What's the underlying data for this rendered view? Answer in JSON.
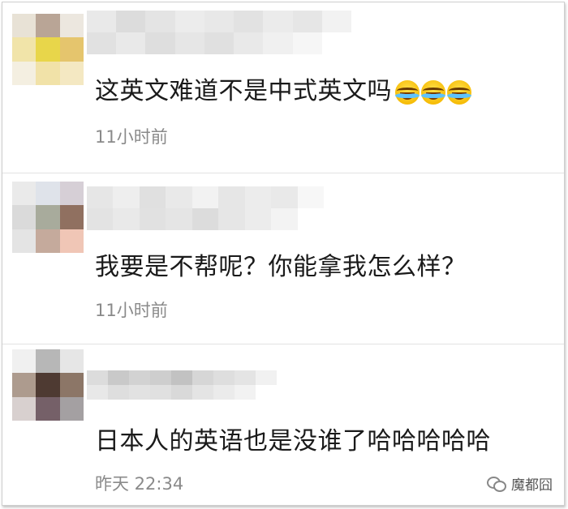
{
  "comments": [
    {
      "text": "这英文难道不是中式英文吗",
      "emojis": [
        "laugh-cry-emoji",
        "laugh-cry-emoji",
        "laugh-cry-emoji"
      ],
      "time": "11小时前",
      "avatar_colors": [
        "#e8e2d6",
        "#b9a596",
        "#ece7df",
        "#f1e4a9",
        "#e8d64a",
        "#e5c56d",
        "#f4efe1",
        "#f1e2a8",
        "#f4e8c2"
      ],
      "username_colors": [
        "#e9e9e9",
        "#dcdcdc",
        "#e4e4e4",
        "#ececec",
        "#e8e8e8",
        "#e2e2e2",
        "#ebebeb",
        "#e6e6e6",
        "#f2f2f2",
        "#e1e1e1",
        "#e9e9e9",
        "#dedede",
        "#e6e6e6",
        "#e0e0e0",
        "#e9e9e9",
        "#f0f0f0",
        "#f6f6f6",
        "#ffffff"
      ]
    },
    {
      "text": "我要是不帮呢？你能拿我怎么样？",
      "emojis": [],
      "time": "11小时前",
      "avatar_colors": [
        "#eaeaea",
        "#dfe3ea",
        "#d6cfd6",
        "#dadada",
        "#a8ab9c",
        "#907060",
        "#e4e4e4",
        "#c5aa9c",
        "#f0c6b6"
      ],
      "username_colors": [
        "#e6e6e6",
        "#eeeeee",
        "#e0e0e0",
        "#e9e9e9",
        "#f2f2f2",
        "#e6e6e6",
        "#ececec",
        "#e9e9e9",
        "#f7f7f7",
        "#e3e3e3",
        "#e9e9e9",
        "#e1e1e1",
        "#e5e5e5",
        "#dcdcdc",
        "#e6e6e6",
        "#ececec",
        "#f3f3f3",
        "#ffffff"
      ]
    },
    {
      "text": "日本人的英语也是没谁了哈哈哈哈哈",
      "emojis": [],
      "time": "昨天 22:34",
      "avatar_colors": [
        "#f0f0f0",
        "#b7b7b7",
        "#e6e6e6",
        "#ad9b8e",
        "#4e3a32",
        "#8c7667",
        "#d8d0cf",
        "#756068",
        "#a4a0a2"
      ],
      "username_colors": [
        "#dcdcdc",
        "#c9c9c9",
        "#d2d2d2",
        "#cecece",
        "#c2c2c2",
        "#d6d6d6",
        "#dedede",
        "#e4e4e4",
        "#f1f1f1",
        "#e8e8e8",
        "#dedede",
        "#e2e2e2",
        "#e0e0e0",
        "#d9d9d9",
        "#e4e4e4",
        "#ebebeb",
        "#f2f2f2",
        "#ffffff"
      ]
    }
  ],
  "watermark": {
    "icon": "wechat-icon",
    "text": "魔都囧"
  }
}
